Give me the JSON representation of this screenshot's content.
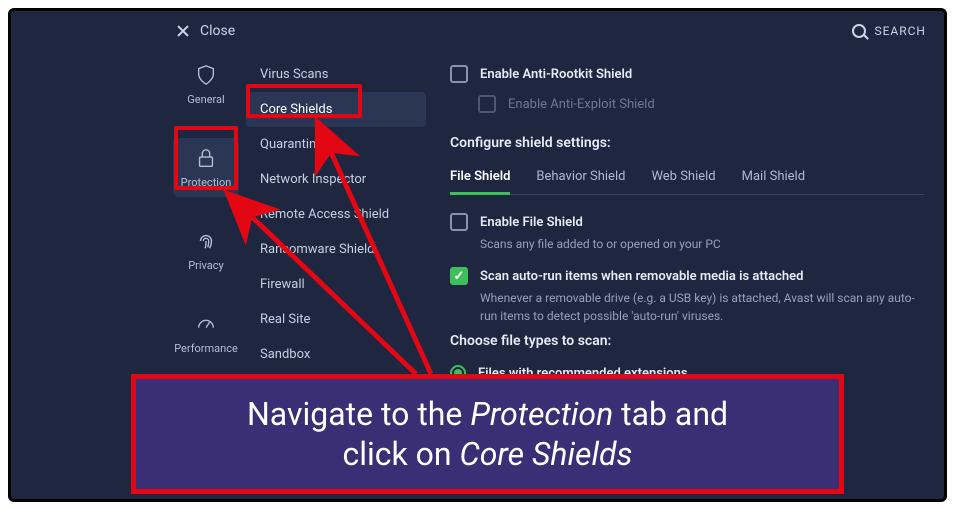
{
  "topbar": {
    "close_label": "Close",
    "search_label": "SEARCH"
  },
  "sidebar": {
    "items": [
      {
        "label": "General"
      },
      {
        "label": "Protection"
      },
      {
        "label": "Privacy"
      },
      {
        "label": "Performance"
      }
    ]
  },
  "submenu": {
    "items": [
      {
        "label": "Virus Scans"
      },
      {
        "label": "Core Shields"
      },
      {
        "label": "Quarantine"
      },
      {
        "label": "Network Inspector"
      },
      {
        "label": "Remote Access Shield"
      },
      {
        "label": "Ransomware Shield"
      },
      {
        "label": "Firewall"
      },
      {
        "label": "Real Site"
      },
      {
        "label": "Sandbox"
      }
    ]
  },
  "content": {
    "rootkit_label": "Enable Anti-Rootkit Shield",
    "exploit_label": "Enable Anti-Exploit Shield",
    "configure_heading": "Configure shield settings:",
    "tabs": [
      {
        "label": "File Shield"
      },
      {
        "label": "Behavior Shield"
      },
      {
        "label": "Web Shield"
      },
      {
        "label": "Mail Shield"
      }
    ],
    "file_shield_label": "Enable File Shield",
    "file_shield_desc": "Scans any file added to or opened on your PC",
    "autorun_label": "Scan auto-run items when removable media is attached",
    "autorun_desc": "Whenever a removable drive (e.g. a USB key) is attached, Avast will scan any auto-run items to detect possible 'auto-run' viruses.",
    "filetypes_heading": "Choose file types to scan:",
    "recommended_label": "Files with recommended extensions"
  },
  "banner": {
    "line1_pre": "Navigate to the ",
    "line1_em": "Protection",
    "line1_post": " tab and ",
    "line2_pre": "click on ",
    "line2_em": "Core Shields"
  }
}
